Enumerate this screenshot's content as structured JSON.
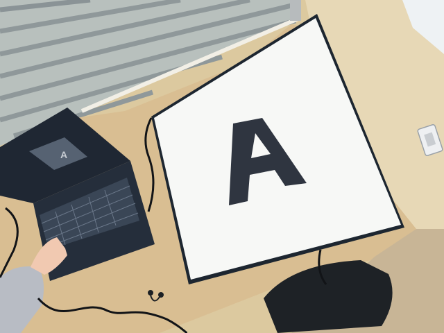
{
  "scene": {
    "photo_kind": "overhead photo of a laptop on a wooden desk beside a large printed letter sign",
    "sign": {
      "letter": "A",
      "letter_color": "#2f3540",
      "paper_color": "#f7f8f6",
      "border_color": "#1d2630"
    },
    "laptop": {
      "screen_letter": "A",
      "body_color": "#1f2733",
      "keyboard_color": "#3a4656"
    },
    "colors": {
      "desk": "#d9be92",
      "wall": "#dcc99f",
      "floor": "#c8b596",
      "blinds": "#9fa8a7",
      "sleeve": "#b8bcc4",
      "skin": "#f1c9b1"
    },
    "icons": [
      "laptop-icon",
      "letter-sign-icon",
      "earphones-icon",
      "power-outlet-icon",
      "hand-icon"
    ]
  }
}
